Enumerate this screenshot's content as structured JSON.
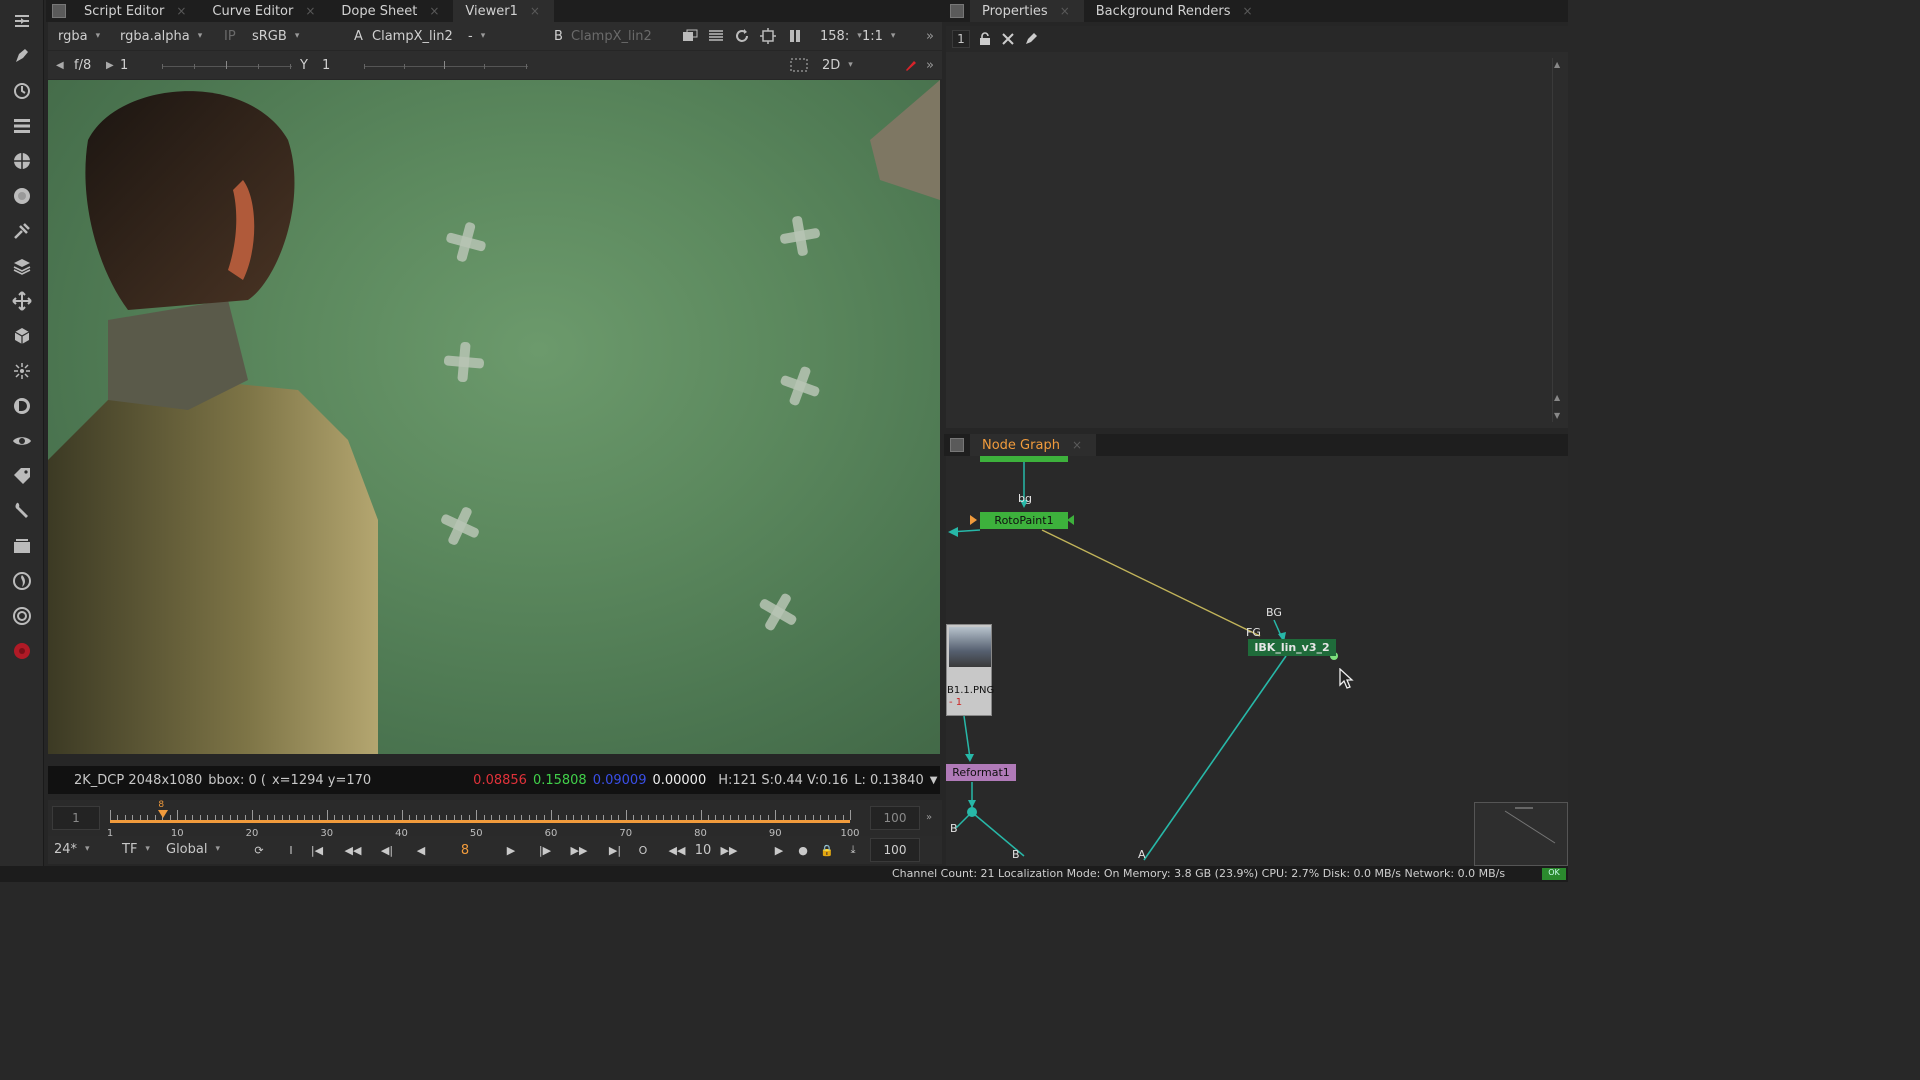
{
  "left_toolbar": {
    "icons": [
      "viewer-toggle-icon",
      "draw-icon",
      "time-icon",
      "channel-icon",
      "color-icon",
      "filter-icon",
      "keyer-icon",
      "merge-icon",
      "transform-icon",
      "3d-icon",
      "particles-icon",
      "deep-icon",
      "views-icon",
      "metadata-icon",
      "toolsets-icon",
      "other-icon",
      "furnace-icon",
      "ocula-icon",
      "cara-vr-icon"
    ]
  },
  "viewer_tabs": [
    {
      "label": "Script Editor",
      "close": "×"
    },
    {
      "label": "Curve Editor",
      "close": "×"
    },
    {
      "label": "Dope Sheet",
      "close": "×"
    },
    {
      "label": "Viewer1",
      "close": "×"
    }
  ],
  "viewer_toolbar": {
    "channels": "rgba",
    "alpha_channel": "rgba.alpha",
    "ip_label": "IP",
    "colorspace": "sRGB",
    "input_a_label": "A",
    "input_a": "ClampX_lin2",
    "wipe": "-",
    "input_b_label": "B",
    "input_b": "ClampX_lin2",
    "frame_rate_display": "158:",
    "zoom": "1:1"
  },
  "viewer_toolbar2": {
    "fstop": "f/8",
    "gain": "1",
    "gamma_label": "Y",
    "gamma": "1",
    "view_mode": "2D"
  },
  "info_bar": {
    "format": "2K_DCP 2048x1080",
    "bbox": "bbox: 0 (",
    "coords": "x=1294 y=170",
    "r": "0.08856",
    "g": "0.15808",
    "b": "0.09009",
    "a": "0.00000",
    "hsv": "H:121 S:0.44 V:0.16",
    "luma": "L: 0.13840",
    "swatch_color": "#486a4c"
  },
  "timeline": {
    "in_frame": "1",
    "out_frame": "100",
    "current_frame_marker": "8",
    "labels": [
      "1",
      "10",
      "20",
      "30",
      "40",
      "50",
      "60",
      "70",
      "80",
      "90",
      "100"
    ]
  },
  "transport": {
    "fps": "24*",
    "tf": "TF",
    "range": "Global",
    "in_btn": "I",
    "out_btn": "O",
    "current_frame": "8",
    "step": "10",
    "end_frame": "100"
  },
  "right_tabs": [
    {
      "label": "Properties",
      "close": "×"
    },
    {
      "label": "Background Renders",
      "close": "×"
    }
  ],
  "properties_toolbar": {
    "max_panels": "1"
  },
  "node_graph_tab": {
    "label": "Node Graph",
    "close": "×"
  },
  "nodes": {
    "rotopaint": "RotoPaint1",
    "ibk": "IBK_lin_v3_2",
    "read": "B1.1.PNG",
    "read_sub": "- 1",
    "reformat": "Reformat1",
    "bg_input_label": "bg",
    "ibk_bg_label": "BG",
    "ibk_fg_label": "FG",
    "b_label": "B",
    "b2_label": "B",
    "a_label": "A"
  },
  "status_bar": {
    "text": "Channel Count: 21  Localization Mode: On  Memory: 3.8 GB (23.9%)  CPU: 2.7%  Disk: 0.0 MB/s  Network: 0.0 MB/s",
    "ok": "OK"
  },
  "colors": {
    "accent_orange": "#f19b3c",
    "node_green": "#3db13c",
    "node_dark_green": "#1f6b3a",
    "node_purple": "#b07ab8",
    "edge_teal": "#27b8a8",
    "edge_yellow": "#c2b45a"
  }
}
